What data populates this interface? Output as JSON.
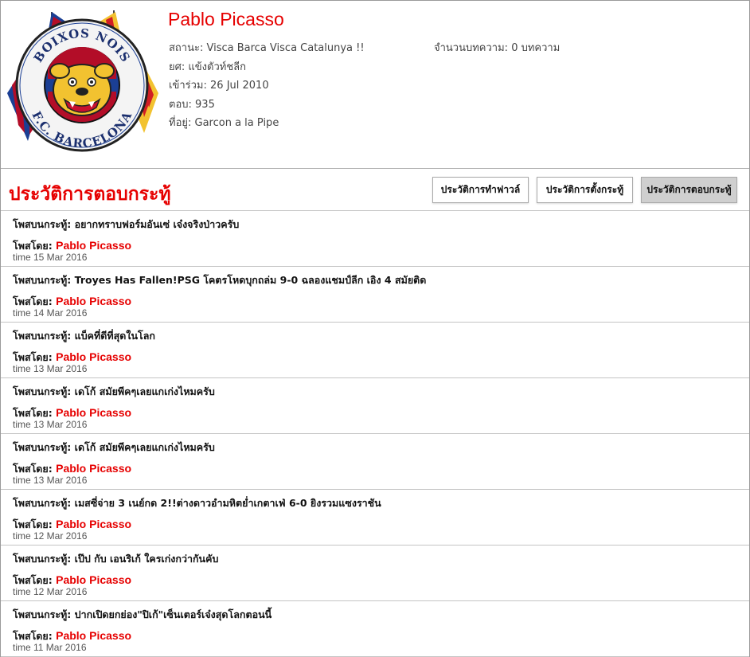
{
  "profile": {
    "name": "Pablo Picasso",
    "logo_text_top": "BOIXOS NOIS",
    "logo_text_bottom": "F.C. BARCELONA",
    "status_label": "สถานะ:",
    "status_value": "Visca Barca Visca Catalunya !!",
    "rank_label": "ยศ:",
    "rank_value": "แข้งตัวท์ชลีก",
    "joined_label": "เข้าร่วม:",
    "joined_value": "26 Jul 2010",
    "replies_label": "ตอบ:",
    "replies_value": "935",
    "location_label": "ที่อยู่:",
    "location_value": "Garcon a la Pipe",
    "posts_label": "จำนวนบทความ:",
    "posts_value": "0 บทความ"
  },
  "section": {
    "title": "ประวัติการตอบกระทู้",
    "tabs": [
      {
        "label": "ประวัติการทำฟาวล์"
      },
      {
        "label": "ประวัติการตั้งกระทู้"
      },
      {
        "label": "ประวัติการตอบกระทู้"
      }
    ]
  },
  "colors": {
    "accent": "#e60000",
    "active_tab": "#cfcfcf"
  },
  "labels": {
    "topic_prefix": "โพสบนกระทู้:",
    "by_prefix": "โพสโดย:"
  },
  "replies": [
    {
      "topic": "อยากทราบฟอร์มอันเซ่ เจ๋งจริงป่าวครับ",
      "author": "Pablo Picasso",
      "time": "time 15 Mar 2016"
    },
    {
      "topic": "Troyes Has Fallen!PSG โคตรโหดบุกถล่ม 9-0 ฉลองแชมป์ลีก เอิง 4 สมัยติด",
      "author": "Pablo Picasso",
      "time": "time 14 Mar 2016"
    },
    {
      "topic": "แบ็คที่ดีที่สุดในโลก",
      "author": "Pablo Picasso",
      "time": "time 13 Mar 2016"
    },
    {
      "topic": "เดโก้ สมัยพีคๆเลยแกเก่งไหมครับ",
      "author": "Pablo Picasso",
      "time": "time 13 Mar 2016"
    },
    {
      "topic": "เดโก้ สมัยพีคๆเลยแกเก่งไหมครับ",
      "author": "Pablo Picasso",
      "time": "time 13 Mar 2016"
    },
    {
      "topic": "เมสซี่จ่าย 3 เนย์กด 2!!ต่างดาวอำมหิตย่ำเกตาเฟ่ 6-0 ยิงรวมแซงราชัน",
      "author": "Pablo Picasso",
      "time": "time 12 Mar 2016"
    },
    {
      "topic": "เป๊ป กับ เอนริเก้ ใครเก่งกว่ากันคับ",
      "author": "Pablo Picasso",
      "time": "time 12 Mar 2016"
    },
    {
      "topic": "ปากเปิดยกย่อง\"ปิเก้\"เซ็นเตอร์เจ๋งสุดโลกตอนนี้",
      "author": "Pablo Picasso",
      "time": "time 11 Mar 2016"
    }
  ]
}
